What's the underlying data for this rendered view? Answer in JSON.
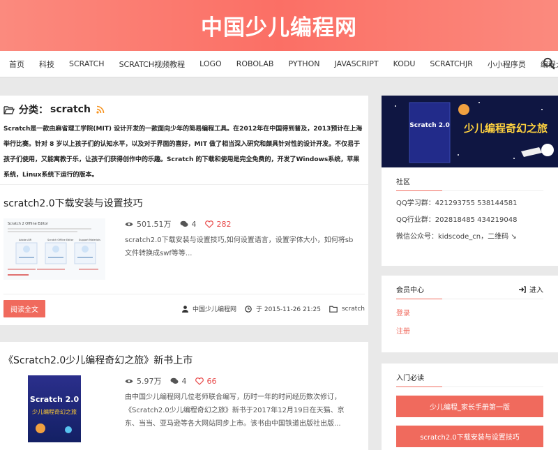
{
  "site": {
    "title": "中国少儿编程网"
  },
  "nav": {
    "items": [
      "首页",
      "科技",
      "SCRATCH",
      "SCRATCH视频教程",
      "LOGO",
      "ROBOLAB",
      "PYTHON",
      "JAVASCRIPT",
      "KODU",
      "SCRATCHJR",
      "小小程序员",
      "编程大作战"
    ],
    "search_icon": "search-icon"
  },
  "category": {
    "label": "分类：",
    "name": "scratch",
    "desc": "Scratch是一款由麻省理工学院(MIT) 设计开发的一款面向少年的简易编程工具。在2012年在中国得到普及，2013预计在上海举行比赛。针对 8 岁以上孩子们的认知水平，以及对于界面的喜好，MIT 做了相当深入研究和颇具针对性的设计开发。不仅易于孩子们使用，又能寓教于乐，让孩子们获得创作中的乐趣。Scratch 的下载和使用是完全免费的，开发了Windows系统，苹果系统，Linux系统下运行的版本。"
  },
  "posts": [
    {
      "title": "scratch2.0下载安装与设置技巧",
      "views": "501.51万",
      "comments": "4",
      "likes": "282",
      "excerpt": "scratch2.0下载安装与设置技巧,如何设置语言，设置字体大小，如何将sb文件转换成swf等等...",
      "read_more": "阅读全文",
      "author": "中国少儿编程网",
      "date": "于 2015-11-26 21:25",
      "category": "scratch",
      "thumb_title": "Scratch 2 Offline Editor",
      "thumb_steps": [
        "Adobe AIR",
        "Scratch Offline Editor",
        "Support Materials"
      ]
    },
    {
      "title": "《Scratch2.0少儿编程奇幻之旅》新书上市",
      "views": "5.97万",
      "comments": "4",
      "likes": "66",
      "excerpt": "由中国少儿编程网几位老师联合编写，历时一年的时间经历数次修订，《Scratch2.0少儿编程奇幻之旅》新书于2017年12月19日在天猫、京东、当当、亚马逊等各大网站同步上市。该书由中国铁道出版社出版...",
      "book_title": "Scratch 2.0",
      "book_sub": "少儿编程奇幻之旅"
    }
  ],
  "sidebar": {
    "banner": {
      "brand": "Scratch 2.0",
      "slogan": "少儿编程奇幻之旅"
    },
    "community": {
      "title": "社区",
      "lines": [
        "QQ学习群：421293755 538144581",
        "QQ行业群：202818485 434219048",
        "微信公众号：kidscode_cn，二维码 ↘"
      ]
    },
    "member": {
      "title": "会员中心",
      "login": "进入",
      "links": [
        "登录",
        "注册"
      ]
    },
    "intro": {
      "title": "入门必读",
      "buttons": [
        "少儿编程_家长手册第一版",
        "scratch2.0下载安装与设置技巧"
      ]
    }
  },
  "colors": {
    "accent": "#f06a5d",
    "header_gradient": "#fb6f65",
    "banner_bg": "#0f1642"
  }
}
